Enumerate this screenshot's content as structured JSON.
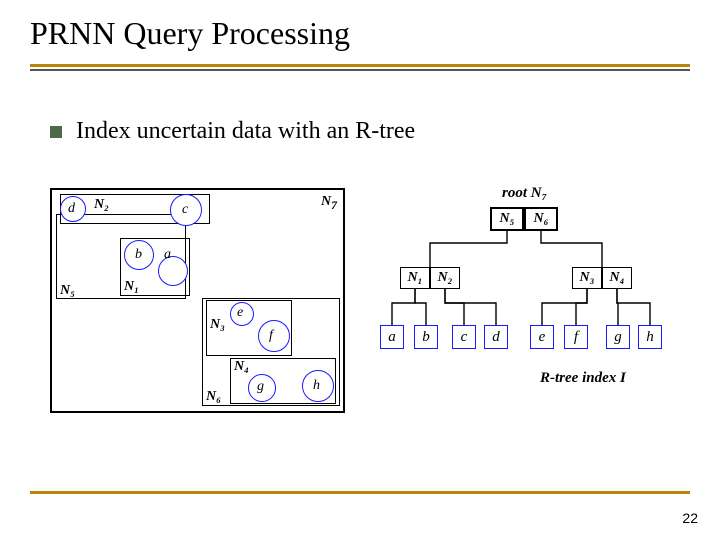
{
  "title": "PRNN Query Processing",
  "bullet": "Index uncertain data with an R-tree",
  "page": "22",
  "spatial": {
    "n7": "N",
    "n7sub": "7",
    "labels": {
      "N1": "N₁",
      "N2": "N₂",
      "N3": "N₃",
      "N4": "N₄",
      "N5": "N₅",
      "N6": "N₆"
    },
    "items": {
      "a": "a",
      "b": "b",
      "c": "c",
      "d": "d",
      "e": "e",
      "f": "f",
      "g": "g",
      "h": "h"
    }
  },
  "tree": {
    "root_label": "root N₇",
    "index_label": "R-tree index I",
    "N5": "N₅",
    "N6": "N₆",
    "N1": "N₁",
    "N2": "N₂",
    "N3": "N₃",
    "N4": "N₄",
    "a": "a",
    "b": "b",
    "c": "c",
    "d": "d",
    "e": "e",
    "f": "f",
    "g": "g",
    "h": "h"
  }
}
